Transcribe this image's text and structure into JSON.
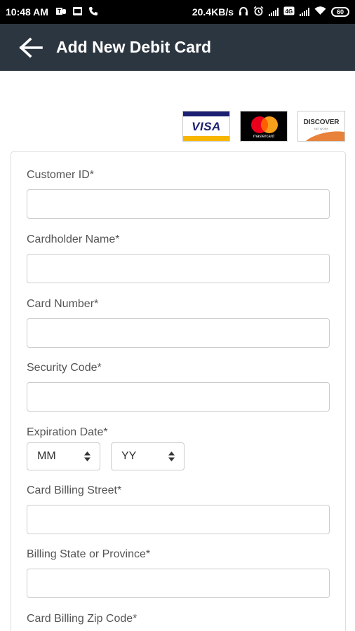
{
  "status_bar": {
    "time": "10:48 AM",
    "network_speed": "20.4KB/s",
    "battery": "60",
    "icons": [
      "teams-icon",
      "outlook-icon",
      "phone-icon",
      "headset-icon",
      "alarm-icon",
      "signal-icon",
      "volte-icon",
      "signal-icon",
      "wifi-icon",
      "battery-icon"
    ]
  },
  "app_bar": {
    "title": "Add New Debit Card",
    "back_icon": "arrow-left-icon",
    "background": "#2c3640"
  },
  "card_logos": {
    "visa": "VISA",
    "mastercard": "mastercard",
    "discover": "DISCOVER",
    "discover_sub": "NETWORK"
  },
  "form": {
    "customer_id": {
      "label": "Customer ID*",
      "value": ""
    },
    "cardholder_name": {
      "label": "Cardholder Name*",
      "value": ""
    },
    "card_number": {
      "label": "Card Number*",
      "value": ""
    },
    "security_code": {
      "label": "Security Code*",
      "value": ""
    },
    "expiration_date": {
      "label": "Expiration Date*",
      "month": "MM",
      "year": "YY"
    },
    "billing_street": {
      "label": "Card Billing Street*",
      "value": ""
    },
    "billing_state": {
      "label": "Billing State or Province*",
      "value": ""
    },
    "billing_zip": {
      "label": "Card Billing Zip Code*",
      "value": ""
    }
  }
}
